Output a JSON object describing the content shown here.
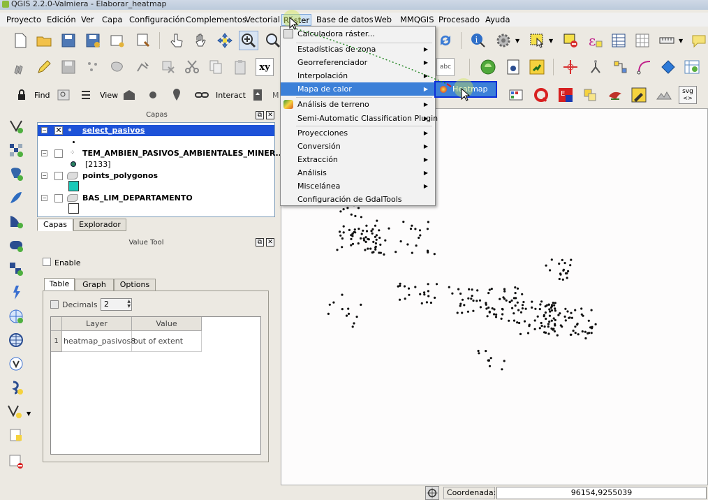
{
  "window": {
    "title": "QGIS 2.2.0-Valmiera - Elaborar_heatmap"
  },
  "menubar": {
    "items": [
      {
        "id": "proyecto",
        "label": "Proyecto"
      },
      {
        "id": "edicion",
        "label": "Edición"
      },
      {
        "id": "ver",
        "label": "Ver"
      },
      {
        "id": "capa",
        "label": "Capa"
      },
      {
        "id": "configuracion",
        "label": "Configuración"
      },
      {
        "id": "complementos",
        "label": "Complementos"
      },
      {
        "id": "vectorial",
        "label": "Vectorial"
      },
      {
        "id": "raster",
        "label": "Ráster"
      },
      {
        "id": "base-datos",
        "label": "Base de datos"
      },
      {
        "id": "web",
        "label": "Web"
      },
      {
        "id": "mmqgis",
        "label": "MMQGIS"
      },
      {
        "id": "procesado",
        "label": "Procesado"
      },
      {
        "id": "ayuda",
        "label": "Ayuda"
      }
    ]
  },
  "toolbar3": {
    "find_label": "Find",
    "view_label": "View",
    "interact_label": "Interact",
    "m_label": "M"
  },
  "layers_panel": {
    "title": "Capas",
    "layers": [
      {
        "name": "select_pasivos",
        "checked": true,
        "selected": true
      },
      {
        "name": "TEM_AMBIEN_PASIVOS_AMBIENTALES_MINER...",
        "checked": false,
        "count": "[2133]"
      },
      {
        "name": "points_polygonos",
        "checked": false
      },
      {
        "name": "BAS_LIM_DEPARTAMENTO",
        "checked": false
      }
    ],
    "tabs": [
      "Capas",
      "Explorador"
    ]
  },
  "value_tool": {
    "title": "Value Tool",
    "enable_label": "Enable",
    "tabs": [
      "Table",
      "Graph",
      "Options"
    ],
    "decimals_label": "Decimals",
    "decimals_value": "2",
    "columns": [
      "Layer",
      "Value"
    ],
    "rows": [
      {
        "index": "1",
        "layer": "heatmap_pasivos8",
        "value": "out of extent"
      }
    ]
  },
  "raster_menu": {
    "items": [
      {
        "label": "Calculadora ráster...",
        "submenu": false
      },
      {
        "label": "Estadísticas de zona",
        "submenu": true
      },
      {
        "label": "Georreferenciador",
        "submenu": true
      },
      {
        "label": "Interpolación",
        "submenu": true
      },
      {
        "label": "Mapa de calor",
        "submenu": true,
        "highlighted": true
      },
      {
        "label": "Análisis de terreno",
        "submenu": true
      },
      {
        "label": "Semi-Automatic Classification Plugin",
        "submenu": true
      },
      {
        "label": "Proyecciones",
        "submenu": true
      },
      {
        "label": "Conversión",
        "submenu": true
      },
      {
        "label": "Extracción",
        "submenu": true
      },
      {
        "label": "Análisis",
        "submenu": true
      },
      {
        "label": "Miscelánea",
        "submenu": true
      },
      {
        "label": "Configuración de GdalTools",
        "submenu": false
      }
    ],
    "submenu_item": "Heatmap"
  },
  "toolbar_text": {
    "abc": "abc",
    "xy": "xy",
    "svg": "svg"
  },
  "status": {
    "coord_label": "Coordenada:",
    "coord_value": "96154,9255039"
  },
  "colors": {
    "highlight": "#3c80d8",
    "selection": "#0b2fd8",
    "points": "#111111"
  }
}
